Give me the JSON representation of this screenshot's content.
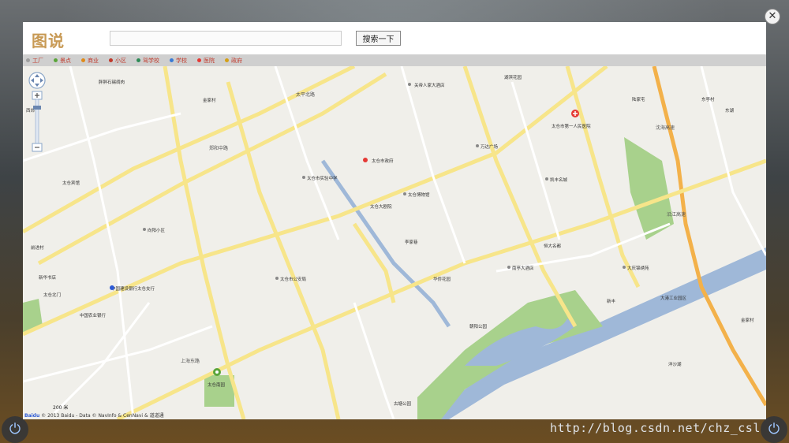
{
  "header": {
    "logo": "图说",
    "search_value": "",
    "search_button": "搜索一下"
  },
  "categories": [
    {
      "label": "工厂",
      "color": "#9e9e9e"
    },
    {
      "label": "景点",
      "color": "#5aa53a"
    },
    {
      "label": "商业",
      "color": "#e08a1a"
    },
    {
      "label": "小区",
      "color": "#c0392b"
    },
    {
      "label": "驾学校",
      "color": "#2e8b57"
    },
    {
      "label": "学校",
      "color": "#3a7bd5"
    },
    {
      "label": "医院",
      "color": "#e53935"
    },
    {
      "label": "政府",
      "color": "#d4a017"
    }
  ],
  "map": {
    "labels": {
      "l1": "胖胖石锡绸肉",
      "l2": "金家村",
      "l3": "关帝人家大酒店",
      "l4": "湖滨花园",
      "l5": "太仓市第一人民医院",
      "l6": "太仓市政府",
      "l7": "太仓市实验中学",
      "l8": "太仓博物馆",
      "l9": "太仓大剧院",
      "l10": "李家巷",
      "l11": "华侨花园",
      "l12": "南亭大酒店",
      "l13": "太仓南园",
      "l14": "中国建设银行太仓支行",
      "l15": "中国农业银行",
      "l16": "新华书店",
      "l17": "朝阳公园",
      "l18": "恒大名都",
      "l19": "大庆锦绣苑",
      "l20": "万达广场",
      "l21": "凯丰名城",
      "l22": "大港工业园区",
      "l23": "金家村",
      "l24": "太仓市公安局",
      "l25": "向阳小区",
      "l26": "前进村",
      "l27": "东亭村",
      "l28": "上海东路",
      "l29": "郑和中路",
      "l30": "太平北路",
      "l31": "沈海高速",
      "l32": "太仓宾馆",
      "l33": "陆家宅",
      "l34": "新丰",
      "l35": "西郊",
      "l36": "东湖",
      "l37": "沿江高速",
      "l38": "洋沙湖",
      "l39": "古塘公园",
      "l40": "太仓北门"
    },
    "scale": "200 米",
    "copyright_brand": "Baidu",
    "copyright_text": "© 2013 Baidu - Data © NavInfo & CenNavi & 道道通"
  },
  "watermark": "http://blog.csdn.net/chz_csl"
}
